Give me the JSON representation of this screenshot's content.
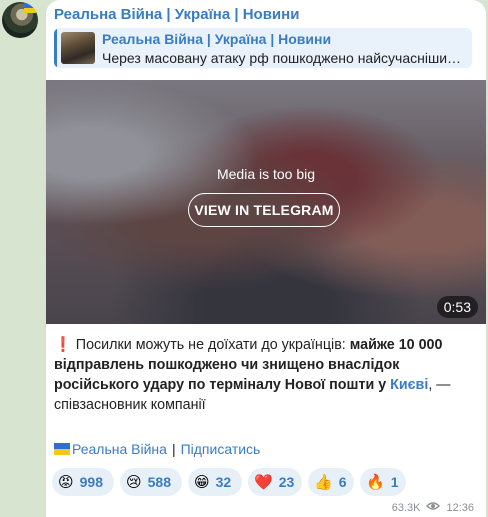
{
  "channel": {
    "name": "Реальна Війна | Україна | Новини"
  },
  "reply": {
    "title": "Реальна Війна | Україна | Новини",
    "text": "Через масовану атаку рф пошкоджено найсучасніши…"
  },
  "media": {
    "notice": "Media is too big",
    "button_label": "VIEW IN TELEGRAM",
    "duration": "0:53"
  },
  "message": {
    "exclamation": "❗️",
    "lead": "Посилки можуть не доїхати до українців: ",
    "bold": "майже 10 000 відправлень пошкоджено чи знищено внаслідок російського удару по терміналу Нової пошти у ",
    "link": "Києві",
    "tail": ", — співзасновник компанії"
  },
  "footer": {
    "channel_link": "Реальна Війна",
    "separator": "|",
    "subscribe_link": "Підписатись"
  },
  "reactions": [
    {
      "emoji": "😡",
      "icon": "angry-face-icon",
      "count": "998"
    },
    {
      "emoji": "😢",
      "icon": "crying-face-icon",
      "count": "588"
    },
    {
      "emoji": "😁",
      "icon": "grinning-face-icon",
      "count": "32"
    },
    {
      "emoji": "❤️",
      "icon": "heart-icon",
      "count": "23"
    },
    {
      "emoji": "👍",
      "icon": "thumbs-up-icon",
      "count": "6"
    },
    {
      "emoji": "🔥",
      "icon": "fire-icon",
      "count": "1"
    }
  ],
  "meta": {
    "views": "63.3K",
    "time": "12:36"
  },
  "colors": {
    "accent": "#3a7cc2",
    "background": "#d7e4cf",
    "reaction_bg": "#e8f0f7"
  }
}
